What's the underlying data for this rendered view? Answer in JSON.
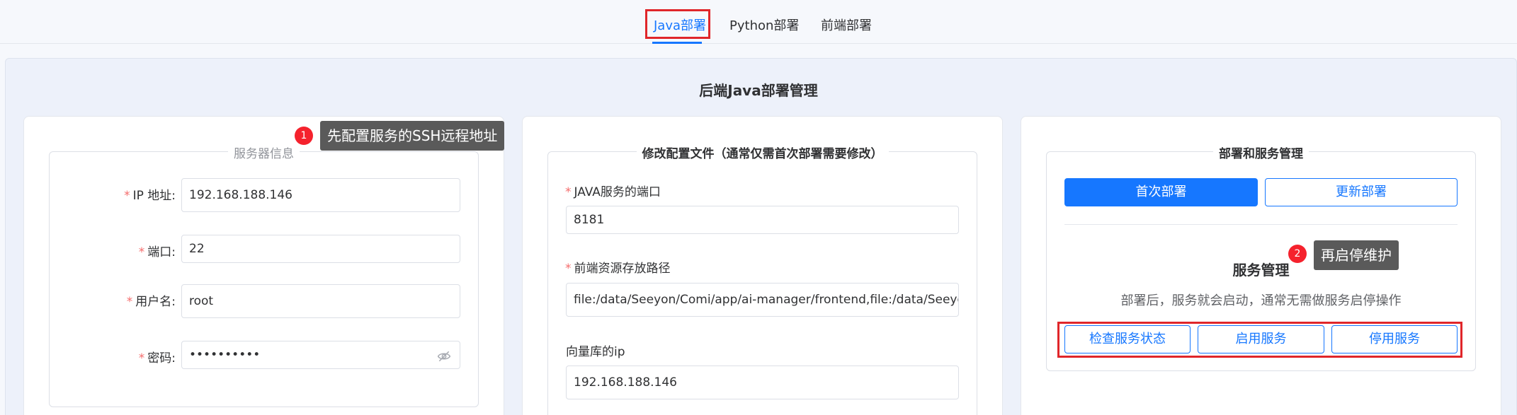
{
  "tabs": [
    {
      "label": "Java部署",
      "active": true
    },
    {
      "label": "Python部署",
      "active": false
    },
    {
      "label": "前端部署",
      "active": false
    }
  ],
  "page_title": "后端Java部署管理",
  "server_card": {
    "legend": "服务器信息",
    "fields": [
      {
        "label": "IP 地址:",
        "value": "192.168.188.146"
      },
      {
        "label": "端口:",
        "value": "22"
      },
      {
        "label": "用户名:",
        "value": "root"
      },
      {
        "label": "密码:",
        "value": "••••••••••"
      }
    ],
    "required_mark": "*"
  },
  "config_card": {
    "legend": "修改配置文件（通常仅需首次部署需要修改）",
    "fields": [
      {
        "label": "JAVA服务的端口",
        "value": "8181",
        "required": true
      },
      {
        "label": "前端资源存放路径",
        "value": "file:/data/Seeyon/Comi/app/ai-manager/frontend,file:/data/Seeyon/C",
        "required": true
      },
      {
        "label": "向量库的ip",
        "value": "192.168.188.146",
        "required": false
      }
    ]
  },
  "deploy_card": {
    "legend": "部署和服务管理",
    "first_deploy": "首次部署",
    "update_deploy": "更新部署",
    "service_title": "服务管理",
    "service_desc": "部署后，服务就会启动，通常无需做服务启停操作",
    "check_status": "检查服务状态",
    "start_service": "启用服务",
    "stop_service": "停用服务"
  },
  "annotations": [
    {
      "number": "1",
      "text": "先配置服务的SSH远程地址"
    },
    {
      "number": "2",
      "text": "再启停维护"
    }
  ],
  "colors": {
    "accent": "#1677ff",
    "highlight": "#e0262a",
    "badge": "#f5222d",
    "required": "#f56c6c"
  }
}
